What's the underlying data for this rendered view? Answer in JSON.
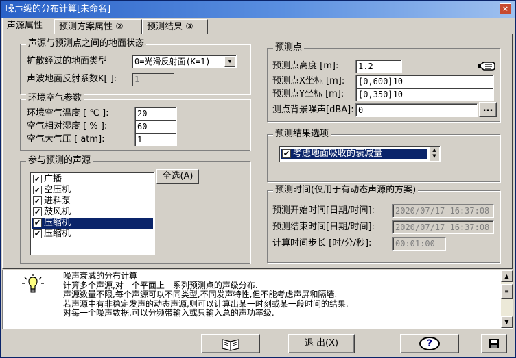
{
  "window": {
    "title": "噪声级的分布计算[未命名]",
    "close_glyph": "×"
  },
  "tabs": [
    {
      "label": "声源属性"
    },
    {
      "label": "预测方案属性 ②"
    },
    {
      "label": "预测结果 ③"
    }
  ],
  "ground": {
    "legend": "声源与预测点之间的地面状态",
    "type_label": "扩散经过的地面类型",
    "type_value": "0=光滑反射面(K=1)",
    "reflect_label": "声波地面反射系数K[ ]:",
    "reflect_value": "1"
  },
  "air": {
    "legend": "环境空气参数",
    "temp_label": "环境空气温度  [ ℃ ]:",
    "temp_value": "20",
    "humidity_label": "空气相对湿度  [  % ]:",
    "humidity_value": "60",
    "pressure_label": "空气大气压    [ atm]:",
    "pressure_value": "1"
  },
  "sources": {
    "legend": "参与预测的声源",
    "select_all": "全选(A)",
    "items": [
      {
        "label": "广播",
        "checked": true,
        "selected": false
      },
      {
        "label": "空压机",
        "checked": true,
        "selected": false
      },
      {
        "label": "进料泵",
        "checked": true,
        "selected": false
      },
      {
        "label": "鼓风机",
        "checked": true,
        "selected": false
      },
      {
        "label": "压缩机",
        "checked": true,
        "selected": true
      },
      {
        "label": "压缩机",
        "checked": true,
        "selected": false
      }
    ]
  },
  "point": {
    "legend": "预测点",
    "height_label": "预测点高度   [m]:",
    "height_value": "1.2",
    "x_label": "预测点X坐标 [m]:",
    "x_value": "[0,600]10",
    "y_label": "预测点Y坐标 [m]:",
    "y_value": "[0,350]10",
    "bg_label": "测点背景噪声[dBA]:",
    "bg_value": "0",
    "more_button": "..."
  },
  "options": {
    "legend": "预测结果选项",
    "item": "考虑地面吸收的衰减量",
    "checked": true
  },
  "time": {
    "legend": "预测时间(仅用于有动态声源的方案)",
    "start_label": "预测开始时间[日期/时间]:",
    "start_value": "2020/07/17 16:37:08",
    "end_label": "预测结束时间[日期/时间]:",
    "end_value": "2020/07/17 16:37:08",
    "step_label": "计算时间步长 [时/分/秒]:",
    "step_value": "00:01:00"
  },
  "description": {
    "lines": [
      "噪声衰减的分布计算",
      "计算多个声源,对一个平面上一系列预测点的声级分布.",
      "声源数量不限,每个声源可以不同类型,不同发声特性,但不能考虑声屏和隔墙.",
      "若声源中有非稳定发声的动态声源,则可以计算出某一时刻或某一段时间的结果.",
      "对每一个噪声数据,可以分频带输入或只输入总的声功率级."
    ]
  },
  "footer": {
    "exit_label": "退 出(X)",
    "help_glyph": "?"
  },
  "icons": {
    "bulb": "lightbulb-icon",
    "book": "book-icon",
    "help": "help-icon",
    "save": "save-icon",
    "pointer": "hand-pointer-icon"
  },
  "colors": {
    "title_bar": "#2a62c8",
    "selection": "#0a246a",
    "window_bg": "#d4d0c8"
  }
}
